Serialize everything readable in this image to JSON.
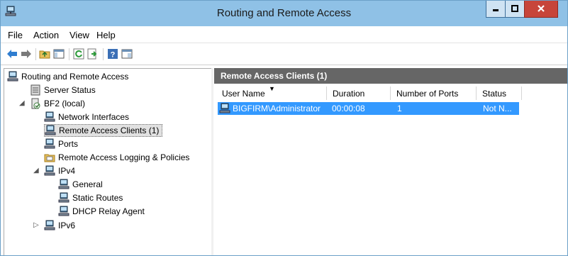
{
  "window": {
    "title": "Routing and Remote Access",
    "accent": "#8fc1e6"
  },
  "menu": [
    "File",
    "Action",
    "View",
    "Help"
  ],
  "toolbar": [
    "back-arrow-icon",
    "forward-arrow-icon",
    "up-folder-icon",
    "show-hide-tree-icon",
    "refresh-icon",
    "export-list-icon",
    "help-icon",
    "properties-icon"
  ],
  "tree": {
    "root": "Routing and Remote Access",
    "server_status": "Server Status",
    "server": "BF2 (local)",
    "network_interfaces": "Network Interfaces",
    "remote_access_clients": "Remote Access Clients (1)",
    "ports": "Ports",
    "logging": "Remote Access Logging & Policies",
    "ipv4": "IPv4",
    "general": "General",
    "static_routes": "Static Routes",
    "dhcp_relay": "DHCP Relay Agent",
    "ipv6": "IPv6"
  },
  "panel": {
    "header": "Remote Access Clients (1)",
    "columns": [
      "User Name",
      "Duration",
      "Number of Ports",
      "Status"
    ],
    "rows": [
      {
        "user": "BIGFIRM\\Administrator",
        "duration": "00:00:08",
        "ports": "1",
        "status": "Not N..."
      }
    ],
    "selection_color": "#3399ff"
  }
}
